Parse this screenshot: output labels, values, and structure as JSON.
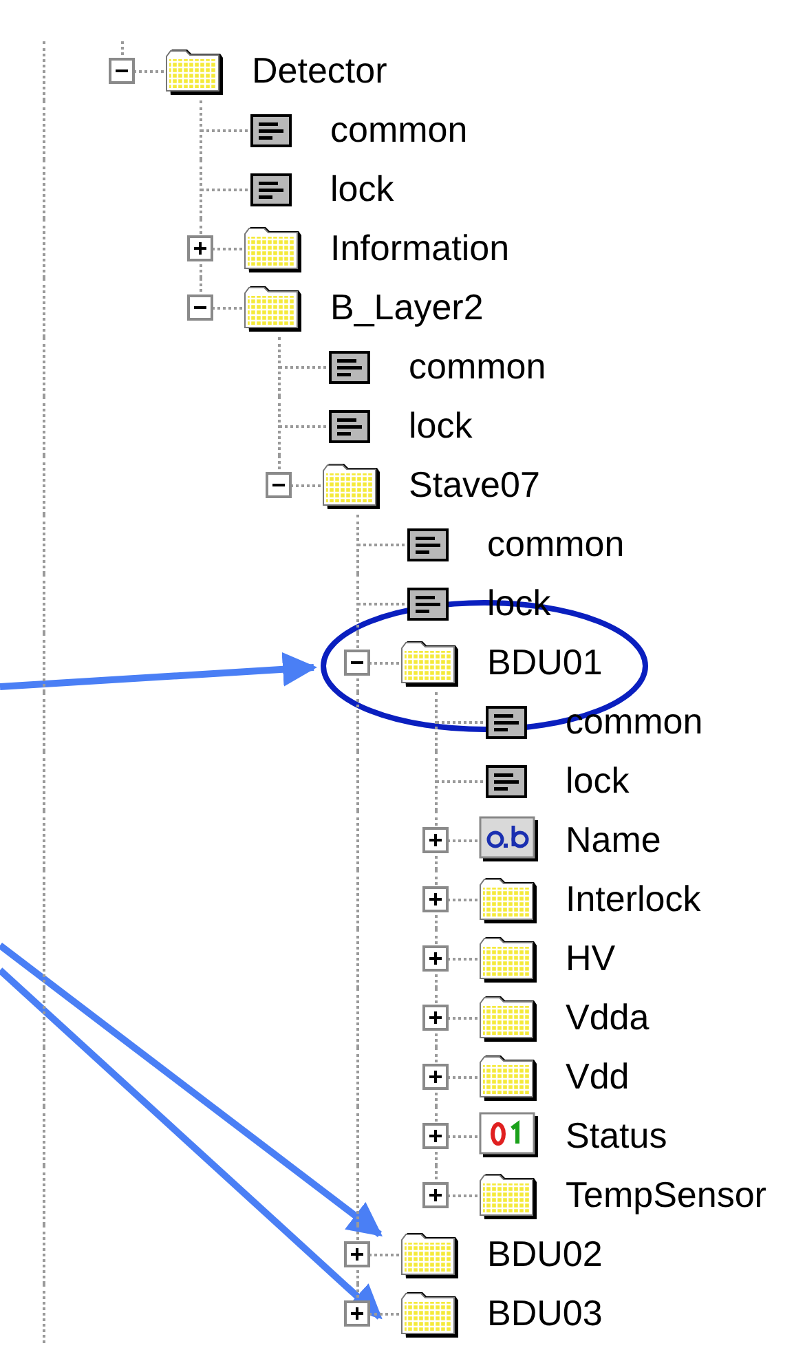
{
  "tree": {
    "items": [
      {
        "label": "Detector",
        "kind": "folder",
        "expanded": true,
        "children": [
          {
            "label": "common",
            "kind": "record"
          },
          {
            "label": "lock",
            "kind": "record"
          },
          {
            "label": "Information",
            "kind": "folder",
            "expanded": false
          },
          {
            "label": "B_Layer2",
            "kind": "folder",
            "expanded": true,
            "children": [
              {
                "label": "common",
                "kind": "record"
              },
              {
                "label": "lock",
                "kind": "record"
              },
              {
                "label": "Stave07",
                "kind": "folder",
                "expanded": true,
                "children": [
                  {
                    "label": "common",
                    "kind": "record"
                  },
                  {
                    "label": "lock",
                    "kind": "record"
                  },
                  {
                    "label": "BDU01",
                    "kind": "folder",
                    "expanded": true,
                    "children": [
                      {
                        "label": "common",
                        "kind": "record"
                      },
                      {
                        "label": "lock",
                        "kind": "record"
                      },
                      {
                        "label": "Name",
                        "kind": "text",
                        "expanded": false
                      },
                      {
                        "label": "Interlock",
                        "kind": "folder",
                        "expanded": false
                      },
                      {
                        "label": "HV",
                        "kind": "folder",
                        "expanded": false
                      },
                      {
                        "label": "Vdda",
                        "kind": "folder",
                        "expanded": false
                      },
                      {
                        "label": "Vdd",
                        "kind": "folder",
                        "expanded": false
                      },
                      {
                        "label": "Status",
                        "kind": "bit",
                        "expanded": false
                      },
                      {
                        "label": "TempSensor",
                        "kind": "folder",
                        "expanded": false
                      }
                    ]
                  },
                  {
                    "label": "BDU02",
                    "kind": "folder",
                    "expanded": false
                  },
                  {
                    "label": "BDU03",
                    "kind": "folder",
                    "expanded": false
                  }
                ]
              }
            ]
          }
        ]
      }
    ]
  }
}
